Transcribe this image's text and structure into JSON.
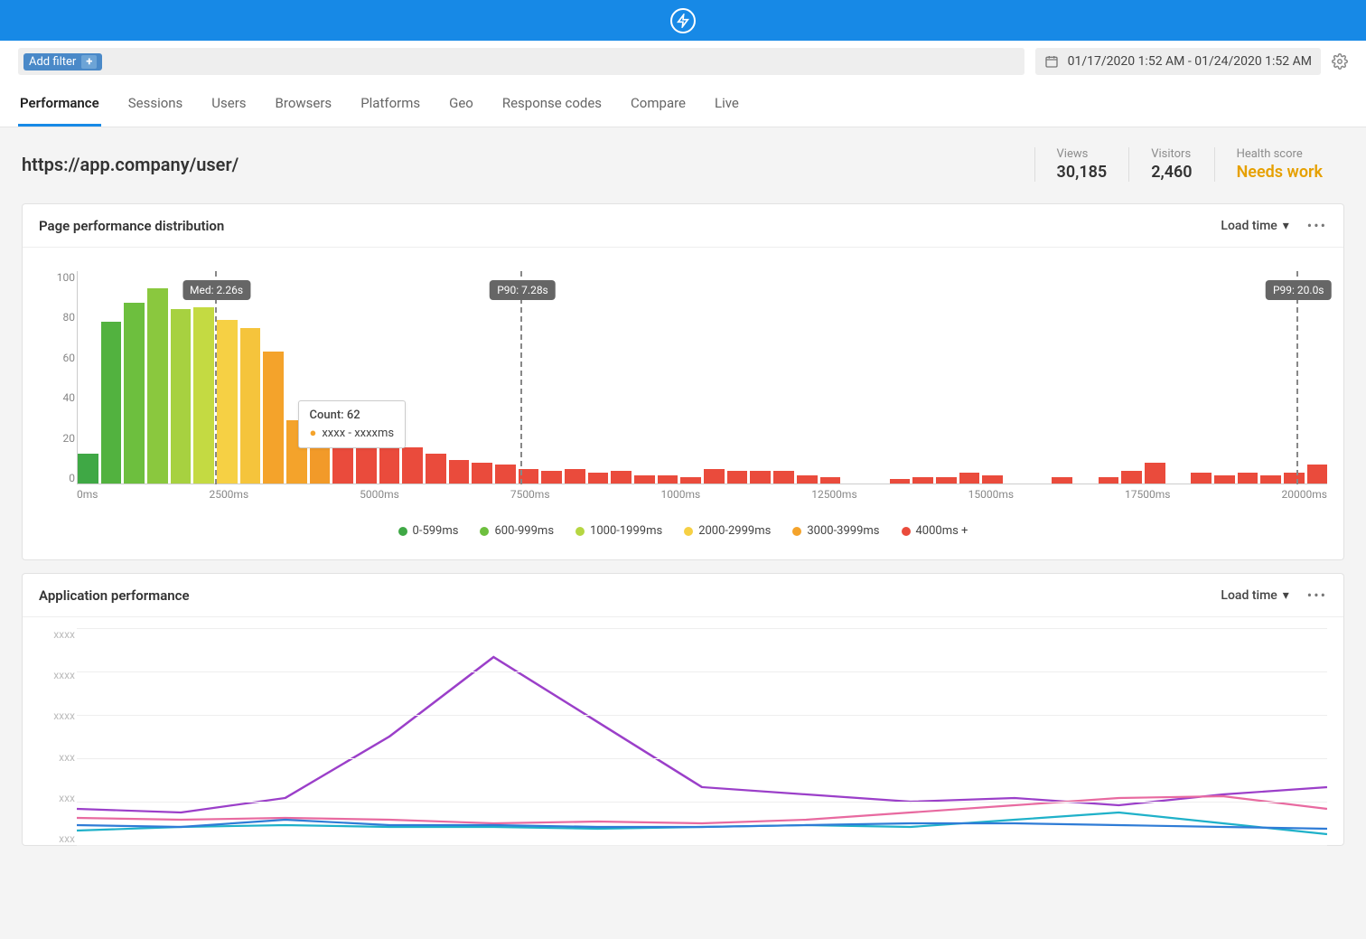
{
  "toolbar": {
    "add_filter_label": "Add filter",
    "date_range": "01/17/2020 1:52 AM - 01/24/2020 1:52 AM"
  },
  "tabs": [
    {
      "label": "Performance",
      "active": true
    },
    {
      "label": "Sessions"
    },
    {
      "label": "Users"
    },
    {
      "label": "Browsers"
    },
    {
      "label": "Platforms"
    },
    {
      "label": "Geo"
    },
    {
      "label": "Response codes"
    },
    {
      "label": "Compare"
    },
    {
      "label": "Live"
    }
  ],
  "page": {
    "url": "https://app.company/user/",
    "stats": {
      "views_label": "Views",
      "views_value": "30,185",
      "visitors_label": "Visitors",
      "visitors_value": "2,460",
      "health_label": "Health score",
      "health_value": "Needs work"
    }
  },
  "hist_panel": {
    "title": "Page performance distribution",
    "metric_selector": "Load time",
    "markers": {
      "med": "Med: 2.26s",
      "p90": "P90: 7.28s",
      "p99": "P99: 20.0s"
    },
    "tooltip": {
      "count": "Count: 62",
      "range": "xxxx - xxxxms"
    },
    "legend": [
      {
        "color": "#3fa845",
        "label": "0-599ms"
      },
      {
        "color": "#6dbf3e",
        "label": "600-999ms"
      },
      {
        "color": "#b6d642",
        "label": "1000-1999ms"
      },
      {
        "color": "#f6d044",
        "label": "2000-2999ms"
      },
      {
        "color": "#f4a32b",
        "label": "3000-3999ms"
      },
      {
        "color": "#ea4b3c",
        "label": "4000ms +"
      }
    ]
  },
  "app_panel": {
    "title": "Application performance",
    "metric_selector": "Load time",
    "y_ticks": [
      "xxxx",
      "xxxx",
      "xxxx",
      "xxx",
      "xxx",
      "xxx"
    ]
  },
  "chart_data": {
    "histogram": {
      "type": "bar",
      "title": "Page performance distribution",
      "x_ticks": [
        "0ms",
        "2500ms",
        "5000ms",
        "7500ms",
        "1000ms",
        "12500ms",
        "15000ms",
        "17500ms",
        "20000ms"
      ],
      "ylim": [
        0,
        100
      ],
      "y_ticks": [
        0,
        20,
        40,
        60,
        80,
        100
      ],
      "markers": {
        "med_s": 2.26,
        "p90_s": 7.28,
        "p99_s": 20.0
      },
      "series": [
        {
          "name": "count",
          "values": [
            {
              "v": 14,
              "c": "#3fa845"
            },
            {
              "v": 76,
              "c": "#52b23f"
            },
            {
              "v": 85,
              "c": "#6dbf3e"
            },
            {
              "v": 92,
              "c": "#8ac83e"
            },
            {
              "v": 82,
              "c": "#a7d140"
            },
            {
              "v": 83,
              "c": "#c4da42"
            },
            {
              "v": 77,
              "c": "#f6d044"
            },
            {
              "v": 73,
              "c": "#f5c43c"
            },
            {
              "v": 62,
              "c": "#f4a32b"
            },
            {
              "v": 30,
              "c": "#f4a32b"
            },
            {
              "v": 20,
              "c": "#f29a29"
            },
            {
              "v": 19,
              "c": "#ea4b3c"
            },
            {
              "v": 19,
              "c": "#ea4b3c"
            },
            {
              "v": 18,
              "c": "#ea4b3c"
            },
            {
              "v": 17,
              "c": "#ea4b3c"
            },
            {
              "v": 14,
              "c": "#ea4b3c"
            },
            {
              "v": 11,
              "c": "#ea4b3c"
            },
            {
              "v": 10,
              "c": "#ea4b3c"
            },
            {
              "v": 9,
              "c": "#ea4b3c"
            },
            {
              "v": 7,
              "c": "#ea4b3c"
            },
            {
              "v": 6,
              "c": "#ea4b3c"
            },
            {
              "v": 7,
              "c": "#ea4b3c"
            },
            {
              "v": 5,
              "c": "#ea4b3c"
            },
            {
              "v": 6,
              "c": "#ea4b3c"
            },
            {
              "v": 4,
              "c": "#ea4b3c"
            },
            {
              "v": 4,
              "c": "#ea4b3c"
            },
            {
              "v": 3,
              "c": "#ea4b3c"
            },
            {
              "v": 7,
              "c": "#ea4b3c"
            },
            {
              "v": 6,
              "c": "#ea4b3c"
            },
            {
              "v": 6,
              "c": "#ea4b3c"
            },
            {
              "v": 6,
              "c": "#ea4b3c"
            },
            {
              "v": 4,
              "c": "#ea4b3c"
            },
            {
              "v": 3,
              "c": "#ea4b3c"
            },
            {
              "v": 0,
              "c": "#ea4b3c"
            },
            {
              "v": 0,
              "c": "#ea4b3c"
            },
            {
              "v": 2,
              "c": "#ea4b3c"
            },
            {
              "v": 3,
              "c": "#ea4b3c"
            },
            {
              "v": 3,
              "c": "#ea4b3c"
            },
            {
              "v": 5,
              "c": "#ea4b3c"
            },
            {
              "v": 4,
              "c": "#ea4b3c"
            },
            {
              "v": 0,
              "c": "#ea4b3c"
            },
            {
              "v": 0,
              "c": "#ea4b3c"
            },
            {
              "v": 3,
              "c": "#ea4b3c"
            },
            {
              "v": 0,
              "c": "#ea4b3c"
            },
            {
              "v": 3,
              "c": "#ea4b3c"
            },
            {
              "v": 6,
              "c": "#ea4b3c"
            },
            {
              "v": 10,
              "c": "#ea4b3c"
            },
            {
              "v": 0,
              "c": "#ea4b3c"
            },
            {
              "v": 5,
              "c": "#ea4b3c"
            },
            {
              "v": 4,
              "c": "#ea4b3c"
            },
            {
              "v": 5,
              "c": "#ea4b3c"
            },
            {
              "v": 4,
              "c": "#ea4b3c"
            },
            {
              "v": 5,
              "c": "#ea4b3c"
            },
            {
              "v": 9,
              "c": "#ea4b3c"
            }
          ]
        }
      ]
    },
    "app_lines": {
      "type": "line",
      "title": "Application performance",
      "x_range": [
        0,
        12
      ],
      "y_range": [
        0,
        6
      ],
      "series": [
        {
          "name": "purple",
          "color": "#9b3fc9",
          "values": [
            1.0,
            0.9,
            1.3,
            3.0,
            5.2,
            3.4,
            1.6,
            1.4,
            1.2,
            1.3,
            1.1,
            1.4,
            1.6
          ]
        },
        {
          "name": "teal",
          "color": "#1fb1c9",
          "values": [
            0.4,
            0.5,
            0.55,
            0.5,
            0.5,
            0.45,
            0.5,
            0.55,
            0.5,
            0.7,
            0.9,
            0.6,
            0.3
          ]
        },
        {
          "name": "pink",
          "color": "#e86aa0",
          "values": [
            0.75,
            0.7,
            0.75,
            0.7,
            0.6,
            0.65,
            0.6,
            0.7,
            0.9,
            1.1,
            1.3,
            1.35,
            1.0
          ]
        },
        {
          "name": "blue",
          "color": "#2f7cd6",
          "values": [
            0.55,
            0.5,
            0.7,
            0.55,
            0.55,
            0.5,
            0.5,
            0.55,
            0.6,
            0.6,
            0.55,
            0.5,
            0.45
          ]
        }
      ]
    }
  }
}
